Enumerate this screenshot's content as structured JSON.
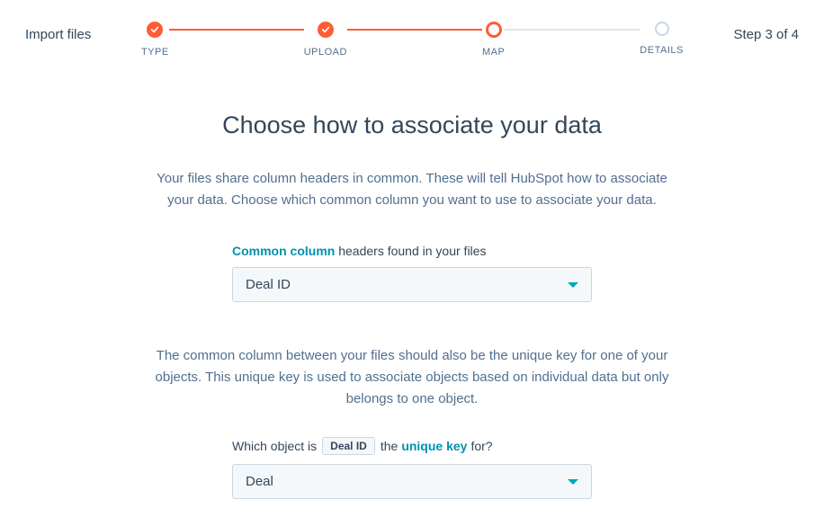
{
  "header": {
    "left": "Import files",
    "right": "Step 3 of 4"
  },
  "stepper": {
    "steps": [
      {
        "label": "TYPE"
      },
      {
        "label": "UPLOAD"
      },
      {
        "label": "MAP"
      },
      {
        "label": "DETAILS"
      }
    ]
  },
  "main": {
    "title": "Choose how to associate your data",
    "description": "Your files share column headers in common. These will tell HubSpot how to associate your data. Choose which common column you want to use to associate your data.",
    "common_column": {
      "label_link": "Common column",
      "label_rest": " headers found in your files",
      "value": "Deal ID"
    },
    "description2": "The common column between your files should also be the unique key for one of your objects. This unique key is used to associate objects based on individual data but only belongs to one object.",
    "unique_key": {
      "q_before": "Which object is",
      "chip": "Deal ID",
      "q_after_1": "the",
      "link": "unique key",
      "q_after_2": "for?",
      "value": "Deal"
    }
  }
}
